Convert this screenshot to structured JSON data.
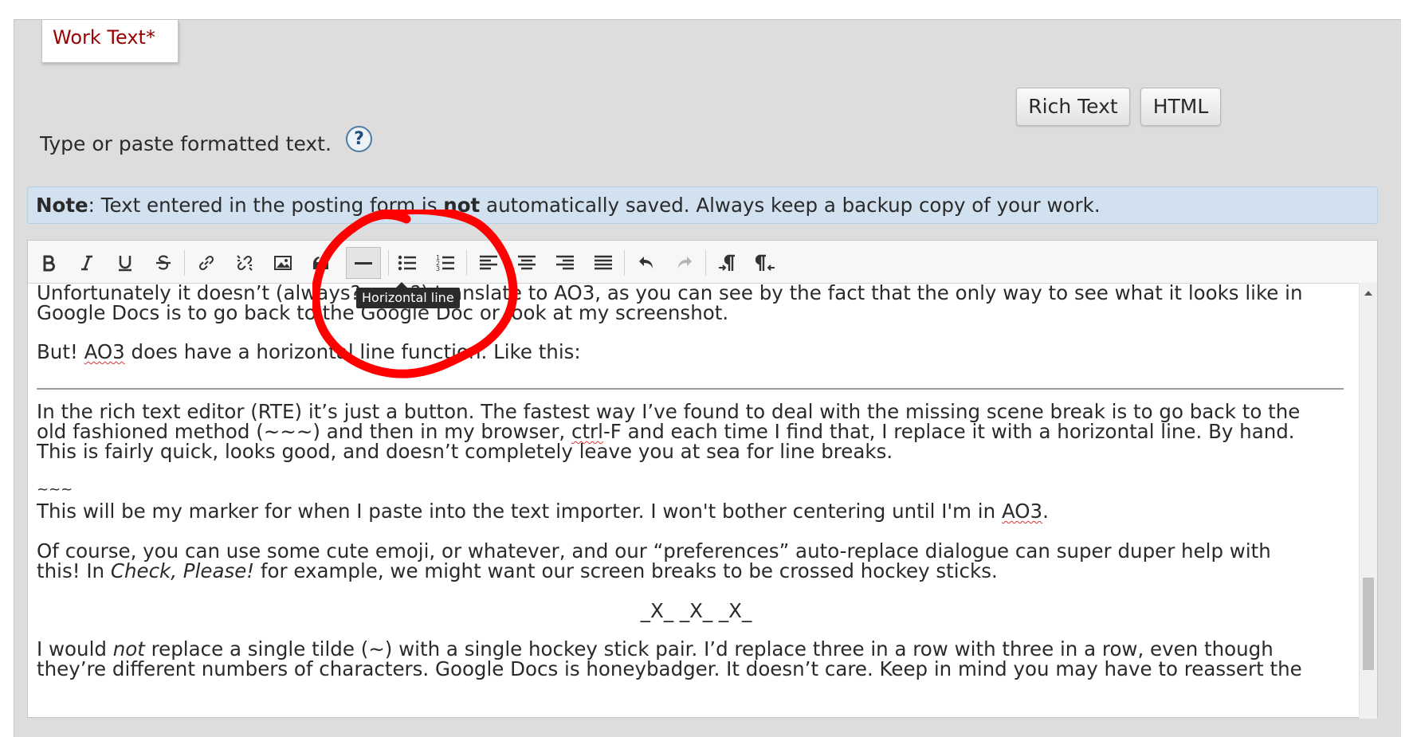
{
  "tab": {
    "label": "Work Text*"
  },
  "modes": {
    "rich_text": "Rich Text",
    "html": "HTML"
  },
  "instructions": {
    "text": "Type or paste formatted text.",
    "help": "?"
  },
  "note": {
    "label": "Note",
    "text_before": ": Text entered in the posting form is ",
    "emphasis": "not",
    "text_after": " automatically saved. Always keep a backup copy of your work."
  },
  "toolbar": {
    "tooltip": "Horizontal line",
    "buttons": [
      "bold",
      "italic",
      "underline",
      "strikethrough",
      "link",
      "unlink",
      "image",
      "blockquote",
      "horizontal-line",
      "bulleted-list",
      "numbered-list",
      "align-left",
      "align-center",
      "align-right",
      "justify",
      "undo",
      "redo",
      "ltr",
      "rtl"
    ]
  },
  "colors": {
    "accent": "#990000",
    "note_bg": "#d1e1ef",
    "annotation": "#ff0000"
  },
  "content": {
    "p1_line1": "Unfortunately it doesn’t (always? ever?) translate to AO3, as you can see by the fact that the only way to see what it looks like in",
    "p1_line2": "Google Docs is to go back to the Google Doc or look at my screenshot.",
    "p2_start": "But! ",
    "p2_ao3": "AO3",
    "p2_end": " does have a horizontal line function. Like this:",
    "p3_line1": "In the rich text editor (RTE) it’s just a button. The fastest way I’ve found to deal with the missing scene break is to go back to the",
    "p3_line2_start": "old fashioned method (~~~) and then in my browser, ",
    "p3_ctrl": "ctrl",
    "p3_line2_end": "-F and each time I find that, I replace it with a horizontal line. By hand.",
    "p3_line3": "This is fairly quick, looks good, and doesn’t completely leave you at sea for line breaks.",
    "marker": "~~~",
    "p4_start": "This will be my marker for when I paste into the text importer. I won't bother centering until I'm in ",
    "p4_ao3": "AO3",
    "p4_end": ".",
    "p5_line1": "Of course, you can use some cute emoji, or whatever, and our “preferences” auto-replace dialogue can super duper help with",
    "p5_line2_start": "this! In ",
    "p5_italic": "Check, Please!",
    "p5_line2_end": " for example, we might want our screen breaks to be crossed hockey sticks.",
    "sticks": "_X_ _X_ _X_",
    "p6_start": "I would ",
    "p6_not": "not",
    "p6_end": " replace a single tilde (~) with a single hockey stick pair. I’d replace three in a row with three in a row, even though",
    "p6_line2": "they’re different numbers of characters. Google Docs is honeybadger. It doesn’t care. Keep in mind you may have to reassert the"
  }
}
